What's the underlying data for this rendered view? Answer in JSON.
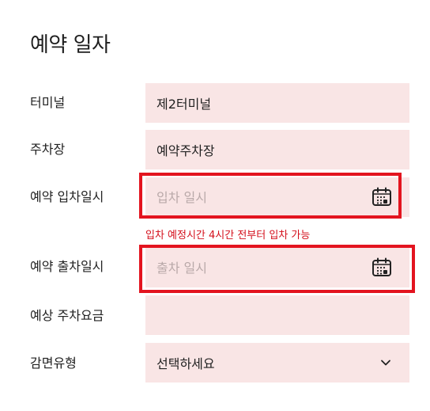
{
  "page_title": "예약 일자",
  "rows": {
    "terminal": {
      "label": "터미널",
      "value": "제2터미널"
    },
    "parking": {
      "label": "주차장",
      "value": "예약주차장"
    },
    "entry": {
      "label": "예약 입차일시",
      "placeholder": "입차 일시",
      "hint": "입차 예정시간 4시간 전부터 입차 가능"
    },
    "exit": {
      "label": "예약 출차일시",
      "placeholder": "출차 일시"
    },
    "fee": {
      "label": "예상 주차요금",
      "value": ""
    },
    "discount": {
      "label": "감면유형",
      "selected": "선택하세요"
    }
  },
  "icons": {
    "calendar": "calendar-icon",
    "dropdown": "chevron-down-icon"
  },
  "colors": {
    "field_bg": "#f9e5e5",
    "highlight": "#e3141f",
    "hint_text": "#d40f1b",
    "placeholder": "#b9a9a9"
  }
}
